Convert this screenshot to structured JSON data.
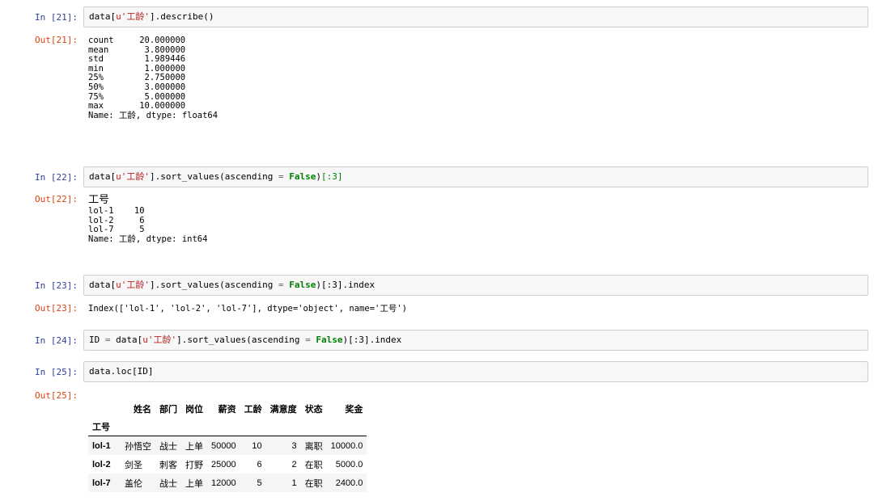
{
  "cells": [
    {
      "in_prompt": "In [21]:",
      "code": "data[u'工龄'].describe()",
      "out_prompt": "Out[21]:",
      "output_lines": [
        "count     20.000000",
        "mean       3.800000",
        "std        1.989446",
        "min        1.000000",
        "25%        2.750000",
        "50%        3.000000",
        "75%        5.000000",
        "max       10.000000",
        "Name: 工龄, dtype: float64"
      ]
    },
    {
      "in_prompt": "In [22]:",
      "code": "data[u'工龄'].sort_values(ascending = False)[:3]",
      "out_prompt": "Out[22]:",
      "output_lines": [
        "工号",
        "lol-1    10",
        "lol-2     6",
        "lol-7     5",
        "Name: 工龄, dtype: int64"
      ]
    },
    {
      "in_prompt": "In [23]:",
      "code": "data[u'工龄'].sort_values(ascending = False)[:3].index",
      "out_prompt": "Out[23]:",
      "output_lines": [
        "Index(['lol-1', 'lol-2', 'lol-7'], dtype='object', name='工号')"
      ]
    },
    {
      "in_prompt": "In [24]:",
      "code": "ID = data[u'工龄'].sort_values(ascending = False)[:3].index"
    },
    {
      "in_prompt": "In [25]:",
      "code": "data.loc[ID]",
      "out_prompt": "Out[25]:"
    }
  ],
  "dataframe": {
    "columns": [
      "姓名",
      "部门",
      "岗位",
      "薪资",
      "工龄",
      "满意度",
      "状态",
      "奖金"
    ],
    "index_name": "工号",
    "rows": [
      {
        "index": "lol-1",
        "values": [
          "孙悟空",
          "战士",
          "上单",
          "50000",
          "10",
          "3",
          "离职",
          "10000.0"
        ]
      },
      {
        "index": "lol-2",
        "values": [
          "剑圣",
          "刺客",
          "打野",
          "25000",
          "6",
          "2",
          "在职",
          "5000.0"
        ]
      },
      {
        "index": "lol-7",
        "values": [
          "盖伦",
          "战士",
          "上单",
          "12000",
          "5",
          "1",
          "在职",
          "2400.0"
        ]
      }
    ]
  },
  "code_tokens": {
    "c21": {
      "pre": "data[",
      "str": "u'工龄'",
      "post": "].describe()"
    },
    "c22": {
      "pre": "data[",
      "str": "u'工龄'",
      "mid": "].sort_values(ascending ",
      "eq": "=",
      "sp": " ",
      "kw": "False",
      "post": ")",
      "slice": "[:3]"
    },
    "c23": {
      "pre": "data[",
      "str": "u'工龄'",
      "mid": "].sort_values(ascending ",
      "eq": "=",
      "sp": " ",
      "kw": "False",
      "post": ")[:3].index"
    },
    "c24": {
      "lhs": "ID ",
      "eq": "=",
      "pre": " data[",
      "str": "u'工龄'",
      "mid": "].sort_values(ascending ",
      "eq2": "=",
      "sp": " ",
      "kw": "False",
      "post": ")[:3].index"
    },
    "c25": {
      "pre": "data.loc[ID]"
    }
  }
}
